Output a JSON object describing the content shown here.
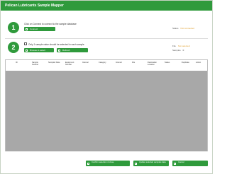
{
  "window": {
    "title": "Pelican Lubricants Sample Mapper"
  },
  "step1": {
    "number": "1",
    "instruction": "Click on Connect to connect to the sample database",
    "button_label": "Connect",
    "status_label": "Status",
    "status_value": "Not connected"
  },
  "step2": {
    "number": "2",
    "checkbox_label": "Only 1 sample value should be selected in each sample",
    "browse_label": "Browse to select",
    "refresh_label": "Refresh",
    "file_label": "File",
    "file_value": "Not selected",
    "samples_label": "Samples",
    "samples_value": "0"
  },
  "table": {
    "columns": [
      "ID",
      "Sample Number",
      "Sampled Date",
      "Equipment Number",
      "Interval",
      "Category",
      "Interval",
      "File",
      "Destination Location",
      "Status",
      "Duplicate",
      "Action"
    ],
    "rows": []
  },
  "footer": {
    "confirm_label": "Confirm selection & close",
    "update_label": "Update selected samples data",
    "cancel_label": "Cancel"
  }
}
